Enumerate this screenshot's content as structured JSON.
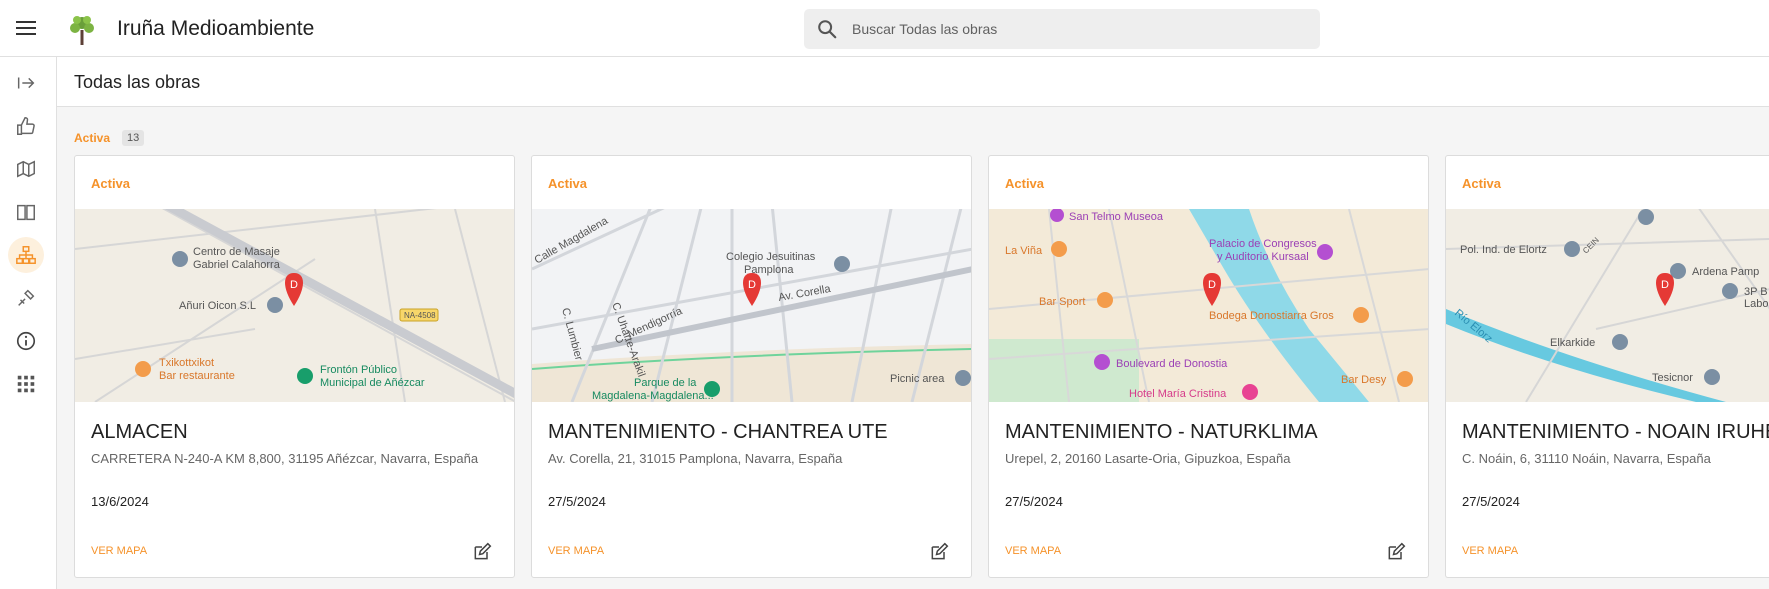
{
  "app": {
    "title": "Iruña Medioambiente",
    "search_placeholder": "Buscar Todas las obras"
  },
  "sidebar": {
    "items": [
      {
        "icon": "logout-arrow-icon",
        "active": false
      },
      {
        "icon": "thumbs-up-icon",
        "active": false
      },
      {
        "icon": "map-icon",
        "active": false
      },
      {
        "icon": "book-icon",
        "active": false
      },
      {
        "icon": "sitemap-icon",
        "active": true
      },
      {
        "icon": "tools-icon",
        "active": false
      },
      {
        "icon": "info-icon",
        "active": false
      },
      {
        "icon": "apps-grid-icon",
        "active": false
      }
    ]
  },
  "page": {
    "title": "Todas las obras",
    "group_label": "Activa",
    "group_count": "13"
  },
  "cards": [
    {
      "status": "Activa",
      "title": "ALMACEN",
      "address": "CARRETERA N-240-A KM 8,800, 31195 Añézcar, Navarra, España",
      "date": "13/6/2024",
      "link": "VER MAPA",
      "map_labels": [
        "Centro de Masaje",
        "Gabriel Calahorra",
        "Añuri Oicon S.L",
        "NA-4508",
        "Txikottxikot",
        "Bar restaurante",
        "Frontón Público",
        "Municipal de Añézcar"
      ]
    },
    {
      "status": "Activa",
      "title": "MANTENIMIENTO - CHANTREA UTE",
      "address": "Av. Corella, 21, 31015 Pamplona, Navarra, España",
      "date": "27/5/2024",
      "link": "VER MAPA",
      "map_labels": [
        "Calle Magdalena",
        "C. Uharte-Arakil",
        "C. Mendigorría",
        "Colegio Jesuitinas",
        "Pamplona",
        "Av. Corella",
        "C. Lumbier",
        "Parque de la",
        "Magdalena-Magdalena...",
        "Picnic area"
      ]
    },
    {
      "status": "Activa",
      "title": "MANTENIMIENTO - NATURKLIMA",
      "address": "Urepel, 2, 20160 Lasarte-Oria, Gipuzkoa, España",
      "date": "27/5/2024",
      "link": "VER MAPA",
      "map_labels": [
        "San Telmo Museoa",
        "La Viña",
        "Palacio de Congresos",
        "y Auditorio Kursaal",
        "Bar Sport",
        "Bodega Donostiarra Gros",
        "Boulevard de Donostia",
        "Hotel María Cristina",
        "Bar Desy"
      ]
    },
    {
      "status": "Activa",
      "title": "MANTENIMIENTO - NOAIN IRUHE",
      "address": "C. Noáin, 6, 31110 Noáin, Navarra, España",
      "date": "27/5/2024",
      "link": "VER MAPA",
      "map_labels": [
        "CEIN",
        "Pol. Ind. de Elortz",
        "Ardena Pamp",
        "3P B",
        "Labo",
        "Río Elorz",
        "Elkarkide",
        "Tesicnor"
      ]
    }
  ],
  "colors": {
    "accent": "#f5922a",
    "pin": "#e53935"
  }
}
